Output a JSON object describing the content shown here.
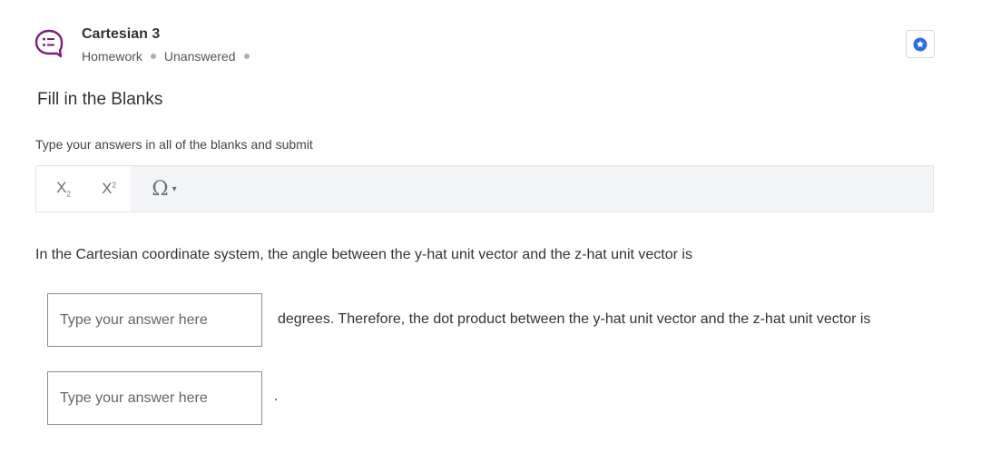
{
  "header": {
    "title": "Cartesian 3",
    "category": "Homework",
    "status": "Unanswered",
    "icon": "question-bubble-icon",
    "accent_color": "#7a1f7a",
    "star_color": "#2b6fd6"
  },
  "question": {
    "heading": "Fill in the Blanks",
    "instruction": "Type your answers in all of the blanks and submit",
    "prompt": "In the Cartesian coordinate system, the angle between the y-hat unit vector and the z-hat unit vector is",
    "blank1": {
      "placeholder": "Type your answer here",
      "value": "",
      "after_text": "degrees.  Therefore, the dot product between the y-hat unit vector and the z-hat unit vector is"
    },
    "blank2": {
      "placeholder": "Type your answer here",
      "value": "",
      "after_text": "."
    }
  },
  "toolbar": {
    "subscript_label": "X",
    "superscript_label": "X",
    "symbol_label": "Ω"
  }
}
